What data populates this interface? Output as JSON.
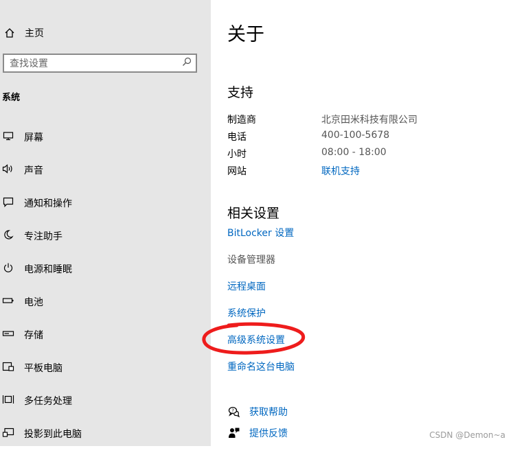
{
  "sidebar": {
    "home_label": "主页",
    "search_placeholder": "查找设置",
    "section_title": "系统",
    "items": [
      {
        "label": "屏幕",
        "icon": "monitor-icon"
      },
      {
        "label": "声音",
        "icon": "speaker-icon"
      },
      {
        "label": "通知和操作",
        "icon": "notification-icon"
      },
      {
        "label": "专注助手",
        "icon": "moon-icon"
      },
      {
        "label": "电源和睡眠",
        "icon": "power-icon"
      },
      {
        "label": "电池",
        "icon": "battery-icon"
      },
      {
        "label": "存储",
        "icon": "storage-icon"
      },
      {
        "label": "平板电脑",
        "icon": "tablet-icon"
      },
      {
        "label": "多任务处理",
        "icon": "multitask-icon"
      },
      {
        "label": "投影到此电脑",
        "icon": "project-icon"
      }
    ]
  },
  "main": {
    "title": "关于",
    "support": {
      "heading": "支持",
      "rows": [
        {
          "key": "制造商",
          "value": "北京田米科技有限公司"
        },
        {
          "key": "电话",
          "value": "400-100-5678"
        },
        {
          "key": "小时",
          "value": "08:00 - 18:00"
        },
        {
          "key": "网站",
          "value": "联机支持"
        }
      ]
    },
    "related": {
      "heading": "相关设置",
      "items": [
        "BitLocker 设置",
        "设备管理器",
        "远程桌面",
        "系统保护",
        "高级系统设置",
        "重命名这台电脑"
      ]
    },
    "help": {
      "get_help": "获取帮助",
      "feedback": "提供反馈"
    }
  },
  "watermark": "CSDN @Demon~a",
  "colors": {
    "sidebar_bg": "#e6e6e6",
    "link": "#0067c0",
    "annotation": "#ee1c1c"
  }
}
